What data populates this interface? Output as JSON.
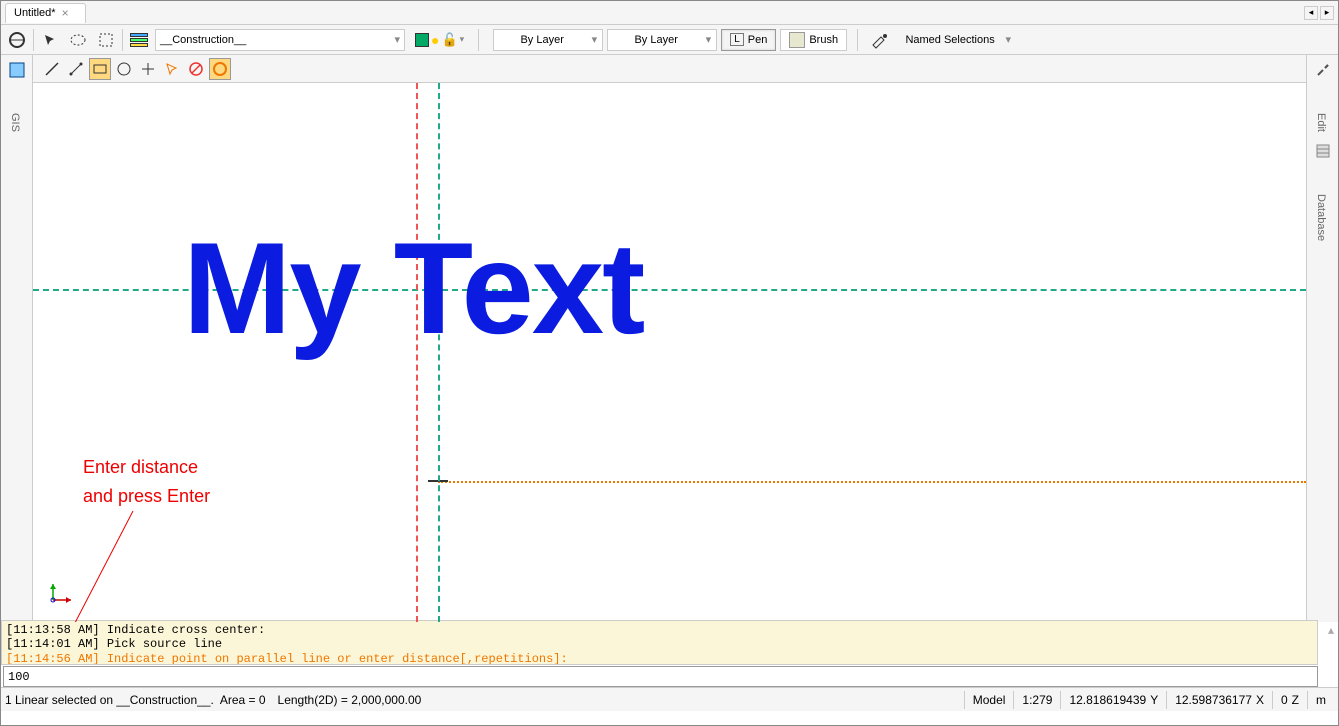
{
  "tab": {
    "title": "Untitled*",
    "nav_prev": "◂",
    "nav_next": "▸"
  },
  "toolbar": {
    "layer_name": "__Construction__",
    "bylayer1": "By Layer",
    "bylayer2": "By Layer",
    "pen_label": "Pen",
    "pen_prefix": "L",
    "brush_label": "Brush",
    "named_sel": "Named Selections"
  },
  "side": {
    "left_label": "GIS",
    "right_label1": "Edit",
    "right_label2": "Database"
  },
  "canvas": {
    "main_text": "My Text"
  },
  "annotation": {
    "line1": "Enter distance",
    "line2": "and press Enter"
  },
  "log": {
    "l1_time": "[11:13:58 AM]",
    "l1_msg": "Indicate cross center:",
    "l2_time": "[11:14:01 AM]",
    "l2_msg": "Pick source line",
    "l3_time": "[11:14:56 AM]",
    "l3_msg": "Indicate point on parallel line or enter distance[,repetitions]:"
  },
  "input": {
    "value": "100"
  },
  "status": {
    "selection": "1 Linear selected on __Construction__.",
    "area": "Area = 0",
    "length": "Length(2D) = 2,000,000.00",
    "model": "Model",
    "scale": "1:279",
    "coord_x": "12.818619439",
    "coord_y": "Y",
    "coord_y_val": "12.598736177",
    "coord_x_lbl": "X",
    "z": "0",
    "z_lbl": "Z",
    "units": "m"
  }
}
